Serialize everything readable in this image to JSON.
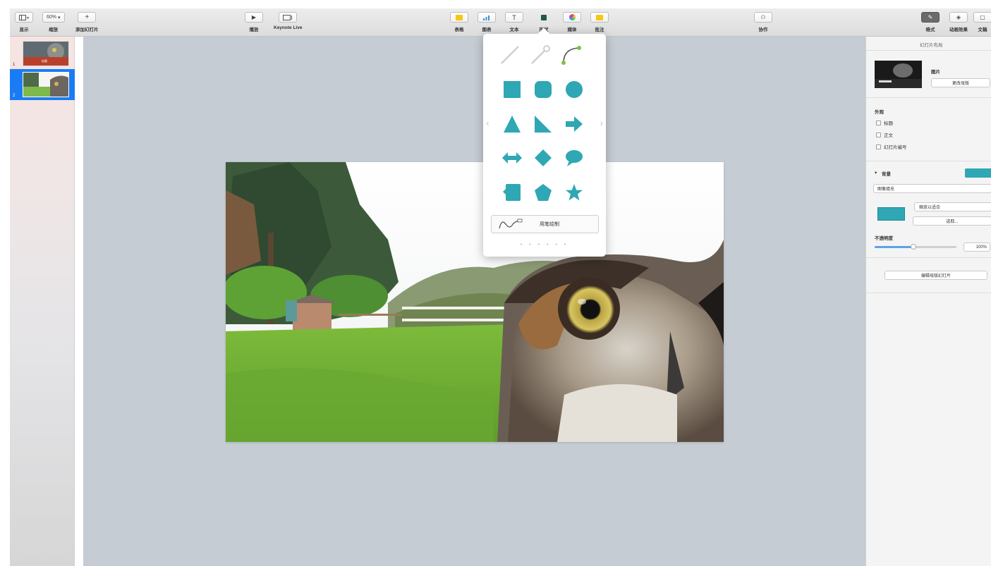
{
  "toolbar": {
    "view": {
      "label": "显示",
      "icon": "sidebar-icon"
    },
    "zoom": {
      "label": "缩放",
      "value": "60%"
    },
    "add_slide": {
      "label": "添加幻灯片",
      "icon": "plus-icon"
    },
    "play": {
      "label": "播放",
      "icon": "play-icon"
    },
    "keynote_live": {
      "label": "Keynote Live",
      "icon": "live-screen-icon"
    },
    "table": {
      "label": "表格",
      "icon": "table-icon"
    },
    "chart": {
      "label": "图表",
      "icon": "chart-icon"
    },
    "text": {
      "label": "文本",
      "icon": "text-icon"
    },
    "shape": {
      "label": "形状",
      "icon": "shape-icon"
    },
    "media": {
      "label": "媒体",
      "icon": "media-icon"
    },
    "comment": {
      "label": "批注",
      "icon": "comment-icon"
    },
    "collaborate": {
      "label": "协作",
      "icon": "collaborate-icon"
    },
    "format": {
      "label": "格式",
      "icon": "format-brush-icon"
    },
    "animate": {
      "label": "动画效果",
      "icon": "animate-icon"
    },
    "document": {
      "label": "文稿",
      "icon": "document-icon"
    }
  },
  "navigator": {
    "slides": [
      {
        "number": "1",
        "badge": "标题"
      },
      {
        "number": "2"
      }
    ]
  },
  "shape_popover": {
    "shapes": [
      "line",
      "line-arrow",
      "connection-line",
      "square",
      "rounded-square",
      "circle",
      "triangle",
      "right-triangle",
      "arrow",
      "double-arrow",
      "diamond",
      "speech-bubble",
      "callout-square",
      "pentagon",
      "star"
    ],
    "draw_with_pen_label": "用笔绘制",
    "page_dots": "• • • • • •",
    "accent": "#2fa7b4"
  },
  "inspector": {
    "tab_title": "幻灯片布局",
    "master": {
      "name": "图片",
      "change_master": "更改母版"
    },
    "appearance": {
      "title": "外观",
      "options": [
        "标题",
        "正文",
        "幻灯片编号"
      ]
    },
    "background": {
      "title": "背景",
      "fill_type": "图像填充",
      "scale_mode": "缩放以适合",
      "choose_button": "选取...",
      "swatch_color": "#2fa7b4"
    },
    "opacity": {
      "label": "不透明度",
      "value": "100%",
      "level": 1.0
    },
    "edit_master_button": "编辑母版幻灯片"
  }
}
